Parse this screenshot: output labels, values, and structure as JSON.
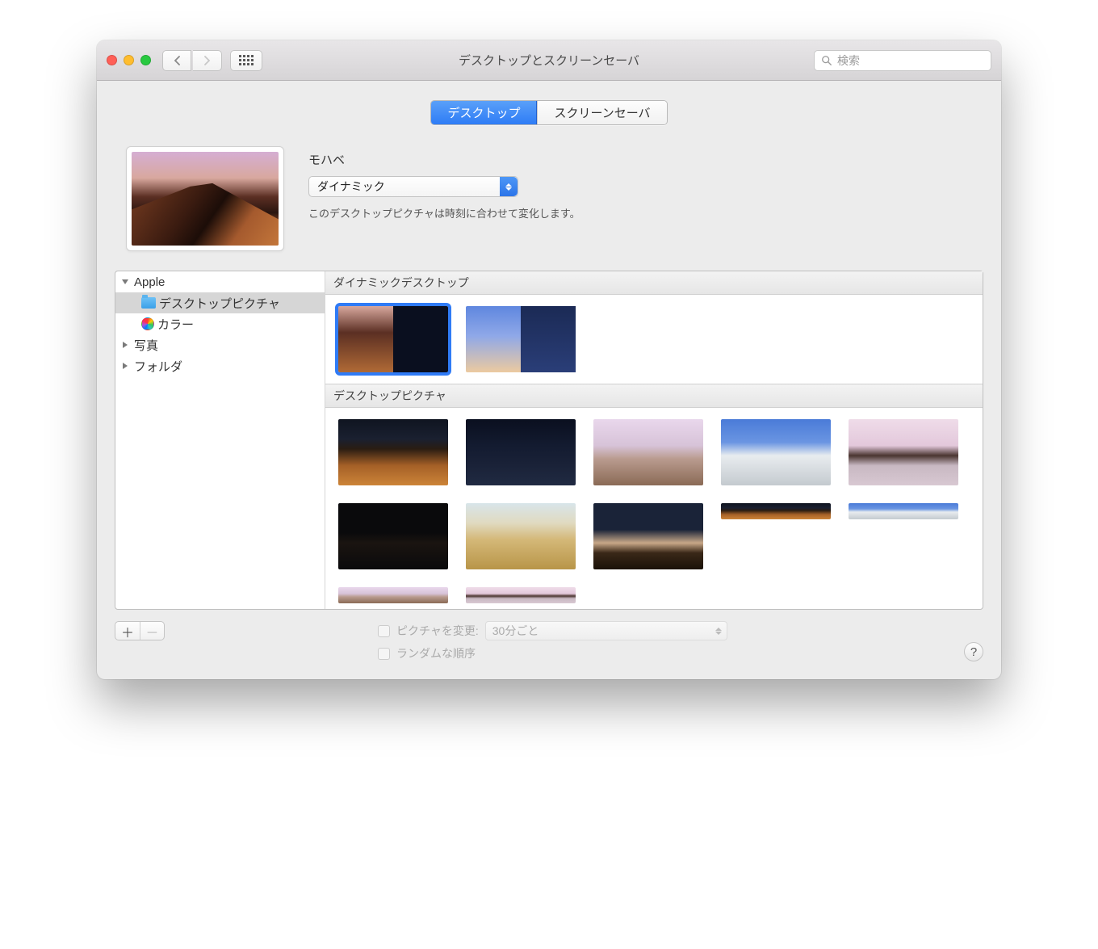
{
  "window": {
    "title": "デスクトップとスクリーンセーバ",
    "search_placeholder": "検索"
  },
  "tabs": {
    "desktop": "デスクトップ",
    "screensaver": "スクリーンセーバ"
  },
  "current": {
    "name": "モハベ",
    "mode": "ダイナミック",
    "description": "このデスクトップピクチャは時刻に合わせて変化します。"
  },
  "sidebar": {
    "apple": "Apple",
    "desktop_pictures": "デスクトップピクチャ",
    "colors": "カラー",
    "photos": "写真",
    "folders": "フォルダ"
  },
  "sections": {
    "dynamic": "ダイナミックデスクトップ",
    "pictures": "デスクトップピクチャ"
  },
  "footer": {
    "change_picture": "ピクチャを変更:",
    "interval": "30分ごと",
    "random": "ランダムな順序",
    "help": "?"
  }
}
